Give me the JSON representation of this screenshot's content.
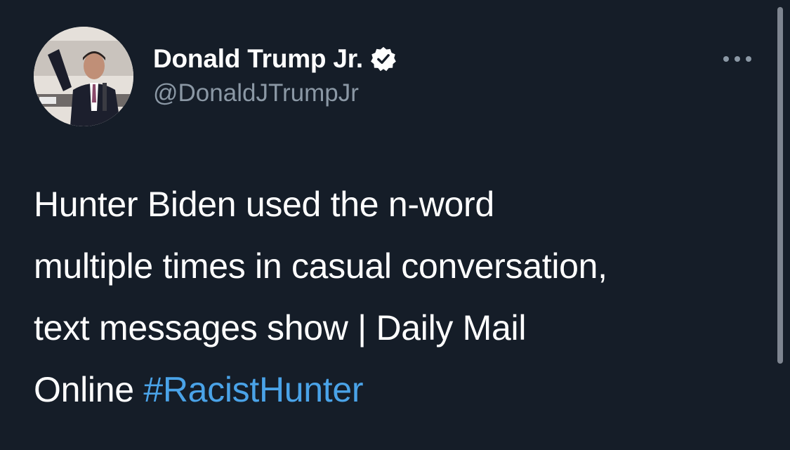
{
  "author": {
    "display_name": "Donald Trump Jr.",
    "handle": "@DonaldJTrumpJr",
    "verified": true,
    "avatar_icon": "profile-photo"
  },
  "actions": {
    "more_icon": "ellipsis-icon"
  },
  "tweet": {
    "lines": [
      "Hunter Biden used the n-word",
      "multiple times in casual conversation,",
      "text messages show | Daily Mail"
    ],
    "last_line_text": "Online",
    "hashtag": "#RacistHunter"
  },
  "colors": {
    "background": "#151d28",
    "text": "#ffffff",
    "handle": "#8b98a5",
    "hashtag": "#4aa3e8",
    "verified_badge": "#ffffff"
  }
}
